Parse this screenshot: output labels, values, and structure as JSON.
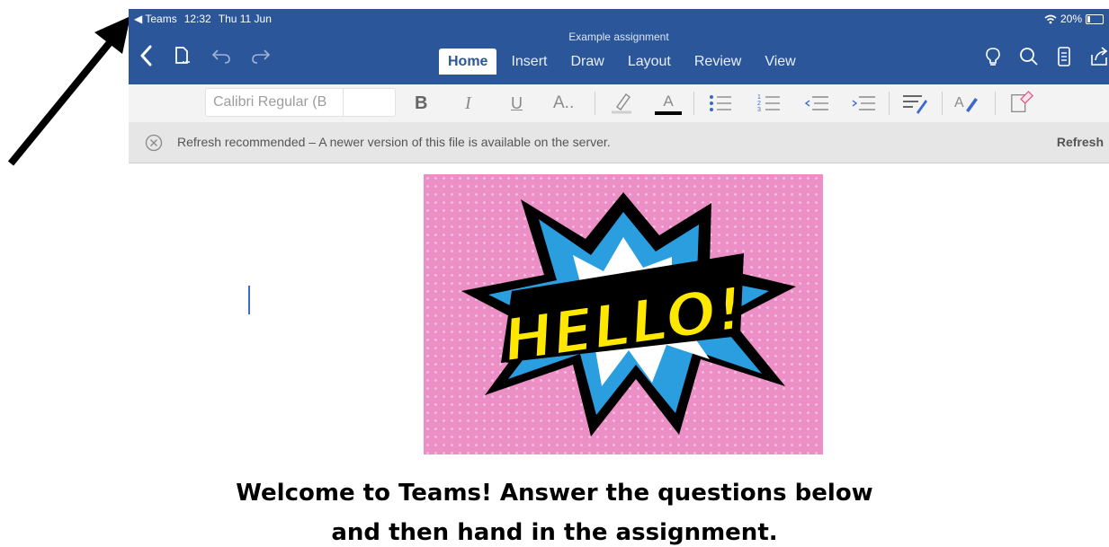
{
  "status_bar": {
    "back_app": "◀ Teams",
    "time": "12:32",
    "date": "Thu 11 Jun",
    "battery": "20%"
  },
  "document": {
    "title": "Example assignment"
  },
  "tabs": [
    {
      "label": "Home",
      "active": true
    },
    {
      "label": "Insert",
      "active": false
    },
    {
      "label": "Draw",
      "active": false
    },
    {
      "label": "Layout",
      "active": false
    },
    {
      "label": "Review",
      "active": false
    },
    {
      "label": "View",
      "active": false
    }
  ],
  "ribbon": {
    "font_name": "Calibri Regular (B",
    "bold": "B",
    "italic": "I",
    "underline": "U",
    "font_size_more": "A..",
    "font_color": "A",
    "styles_label": "A"
  },
  "notification": {
    "message": "Refresh recommended – A newer version of this file is available on the server.",
    "action": "Refresh"
  },
  "image": {
    "caption": "HELLO!"
  },
  "heading": {
    "line1": "Welcome to Teams! Answer the questions below",
    "line2": "and then hand in the assignment."
  },
  "colors": {
    "word_blue": "#2b579a",
    "notice_bg": "#e6e6e6",
    "hello_bg": "#ec8fc6",
    "burst_blue": "#2b9ee0",
    "hello_yellow": "#ffe800"
  },
  "icons": [
    "back-chevron-icon",
    "file-icon",
    "undo-icon",
    "redo-icon",
    "lightbulb-icon",
    "search-icon",
    "tablet-view-icon",
    "share-icon",
    "highlighter-icon",
    "bullets-icon",
    "numbering-icon",
    "outdent-icon",
    "indent-icon",
    "styles-icon",
    "pen-icon",
    "clear-format-icon",
    "close-circle-icon"
  ]
}
